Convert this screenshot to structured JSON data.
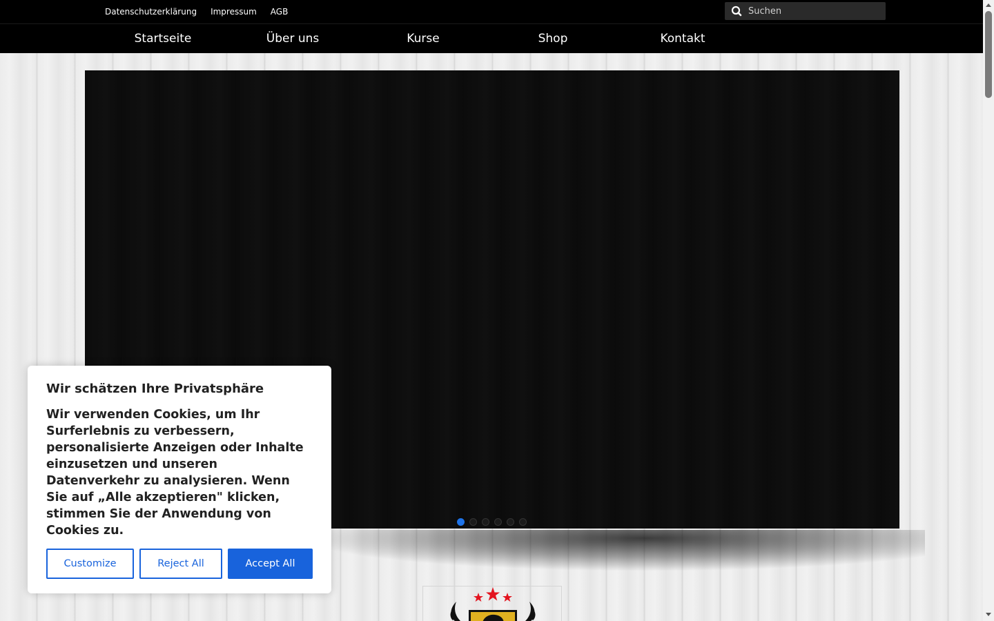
{
  "topbar": {
    "links": [
      "Datenschutzerklärung",
      "Impressum",
      "AGB"
    ],
    "search": {
      "placeholder": "Suchen",
      "icon": "search-icon"
    }
  },
  "nav": {
    "items": [
      "Startseite",
      "Über uns",
      "Kurse",
      "Shop",
      "Kontakt"
    ]
  },
  "slider": {
    "slide_count": 6,
    "active_slide": 1,
    "active_dot_color": "#1e73e8"
  },
  "logo": {
    "icon": "club-crest-logo",
    "star_color": "#e3141f",
    "shield_color": "#e0b020"
  },
  "cookie_banner": {
    "title": "Wir schätzen Ihre Privatsphäre",
    "message": "Wir verwenden Cookies, um Ihr Surferlebnis zu verbessern, personalisierte Anzeigen oder Inhalte einzusetzen und unseren Datenverkehr zu analysieren. Wenn Sie auf „Alle akzeptieren\" klicken, stimmen Sie der Anwendung von Cookies zu.",
    "customize_label": "Customize",
    "reject_label": "Reject All",
    "accept_label": "Accept All",
    "accent_color": "#1863dc"
  }
}
